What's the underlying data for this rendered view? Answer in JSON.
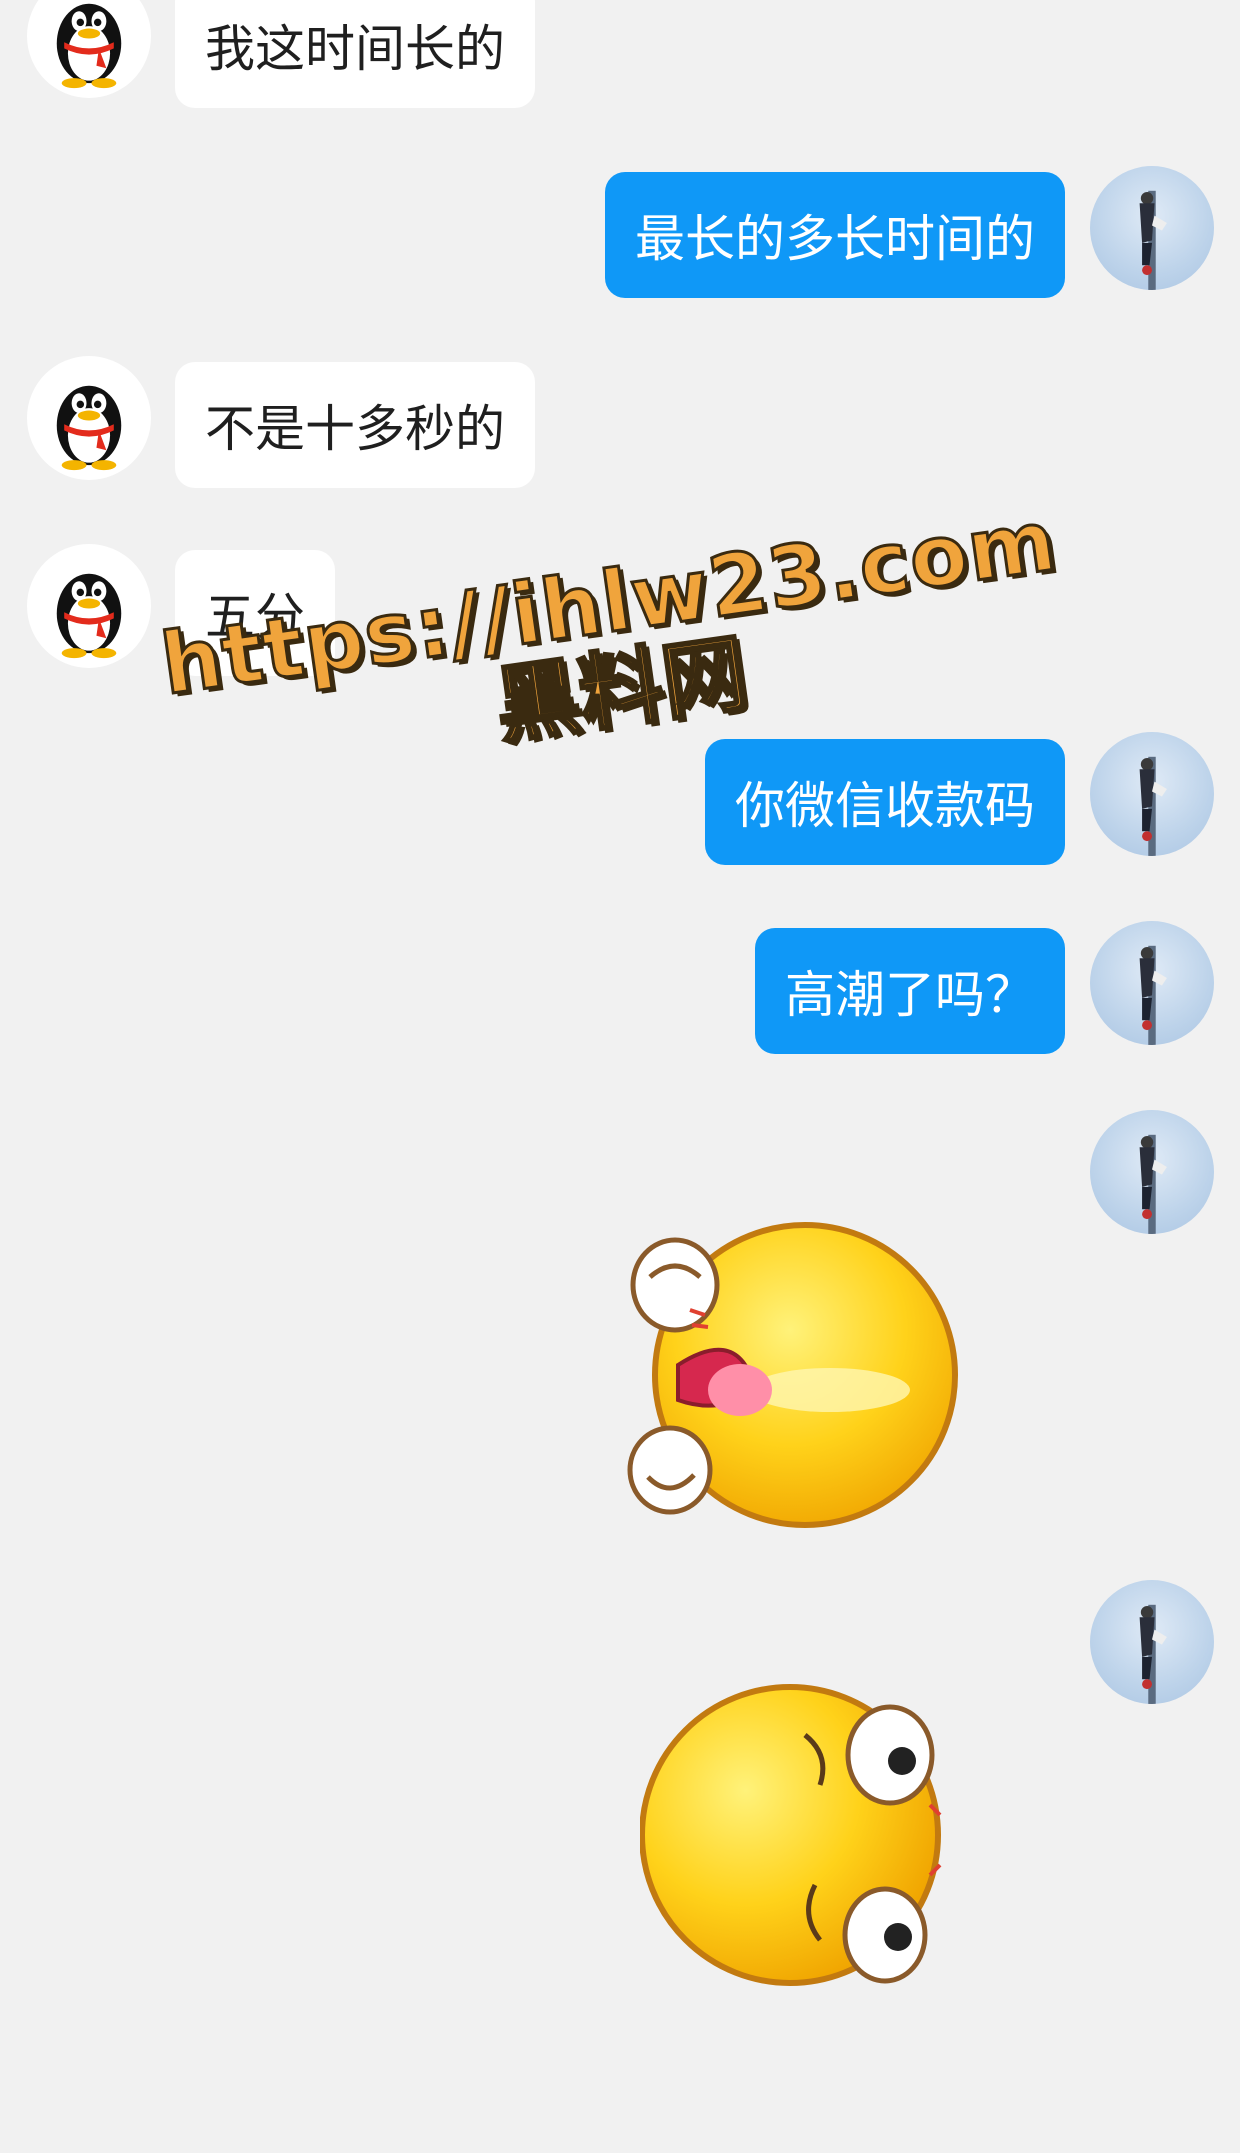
{
  "messages": [
    {
      "side": "in",
      "text": "我这时间长的"
    },
    {
      "side": "out",
      "text": "最长的多长时间的"
    },
    {
      "side": "in",
      "text": "不是十多秒的"
    },
    {
      "side": "in",
      "text": "五分"
    },
    {
      "side": "out",
      "text": "你微信收款码"
    },
    {
      "side": "out",
      "text": "高潮了吗？"
    },
    {
      "side": "out",
      "sticker": "cute-emoji-tongue-sticker"
    },
    {
      "side": "out",
      "sticker": "cute-emoji-rolling-sticker"
    }
  ],
  "watermark": {
    "url": "https://ihlw23.com",
    "name": "黑料网"
  },
  "colors": {
    "background": "#f1f1f1",
    "incoming_bubble": "#ffffff",
    "outgoing_bubble": "#0f98f7",
    "watermark": "#f0a43c"
  },
  "icons": {
    "incoming_avatar": "qq-penguin-avatar-icon",
    "outgoing_avatar": "user-photo-avatar-icon"
  }
}
